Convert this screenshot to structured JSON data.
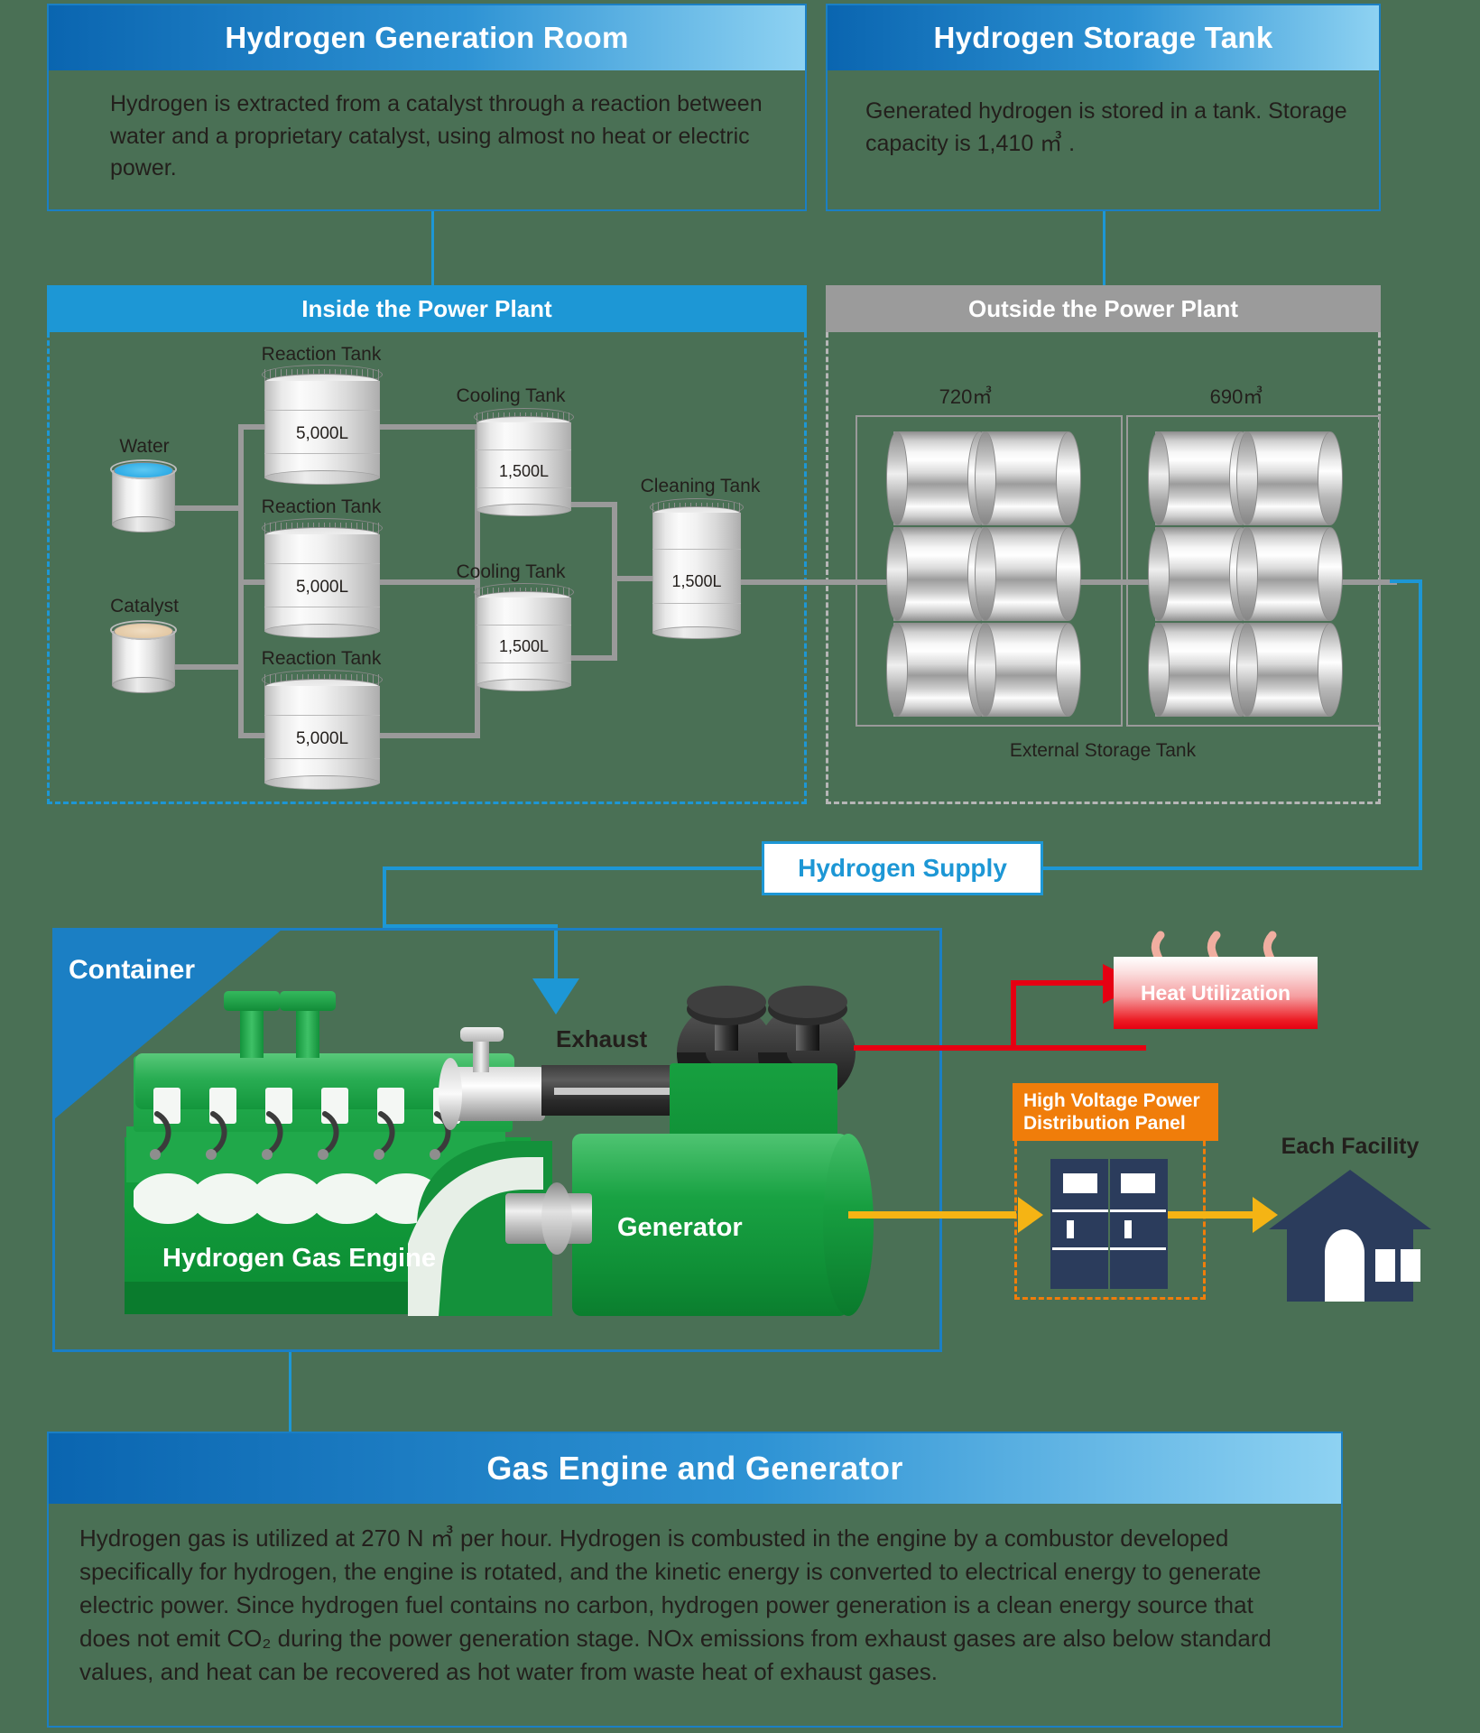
{
  "background_color": "#4a7055",
  "accent_blue": "#1d97d5",
  "accent_orange": "#f07d0a",
  "accent_red": "#e60012",
  "accent_yellow": "#f5b414",
  "panels": {
    "generation_room": {
      "title": "Hydrogen Generation Room",
      "body": "Hydrogen is extracted from a catalyst through a reaction between water and a proprietary catalyst, using almost no heat or electric power."
    },
    "storage_tank": {
      "title": "Hydrogen Storage Tank",
      "body": "Generated hydrogen is stored in a tank. Storage capacity is 1,410 ㎥ ."
    },
    "gas_engine": {
      "title": "Gas Engine and Generator",
      "body": "Hydrogen gas is utilized at 270 N ㎥ per hour. Hydrogen is combusted in the engine by a combustor developed specifically for hydrogen, the engine is rotated, and the kinetic energy is converted to electrical energy to generate electric power. Since hydrogen fuel contains no carbon, hydrogen power generation is a clean energy source that does not emit CO₂ during the power generation stage. NOx emissions from exhaust gases are also below standard values, and heat can be recovered as hot water from waste heat of exhaust gases."
    }
  },
  "sections": {
    "inside_plant": "Inside the Power Plant",
    "outside_plant": "Outside the Power Plant"
  },
  "plant": {
    "inputs": [
      {
        "label": "Water"
      },
      {
        "label": "Catalyst"
      }
    ],
    "reaction_tanks": [
      {
        "label": "Reaction Tank",
        "volume": "5,000L"
      },
      {
        "label": "Reaction Tank",
        "volume": "5,000L"
      },
      {
        "label": "Reaction Tank",
        "volume": "5,000L"
      }
    ],
    "cooling_tanks": [
      {
        "label": "Cooling Tank",
        "volume": "1,500L"
      },
      {
        "label": "Cooling Tank",
        "volume": "1,500L"
      }
    ],
    "cleaning_tank": {
      "label": "Cleaning Tank",
      "volume": "1,500L"
    }
  },
  "outside": {
    "bank_left_capacity": "720㎥",
    "bank_right_capacity": "690㎥",
    "caption": "External Storage Tank"
  },
  "supply": {
    "label": "Hydrogen Supply"
  },
  "container": {
    "label": "Container",
    "engine_label": "Hydrogen Gas Engine",
    "generator_label": "Generator",
    "exhaust_label": "Exhaust"
  },
  "outputs": {
    "heat": "Heat Utilization",
    "panel_line1": "High Voltage Power",
    "panel_line2": "Distribution Panel",
    "facility": "Each Facility"
  }
}
